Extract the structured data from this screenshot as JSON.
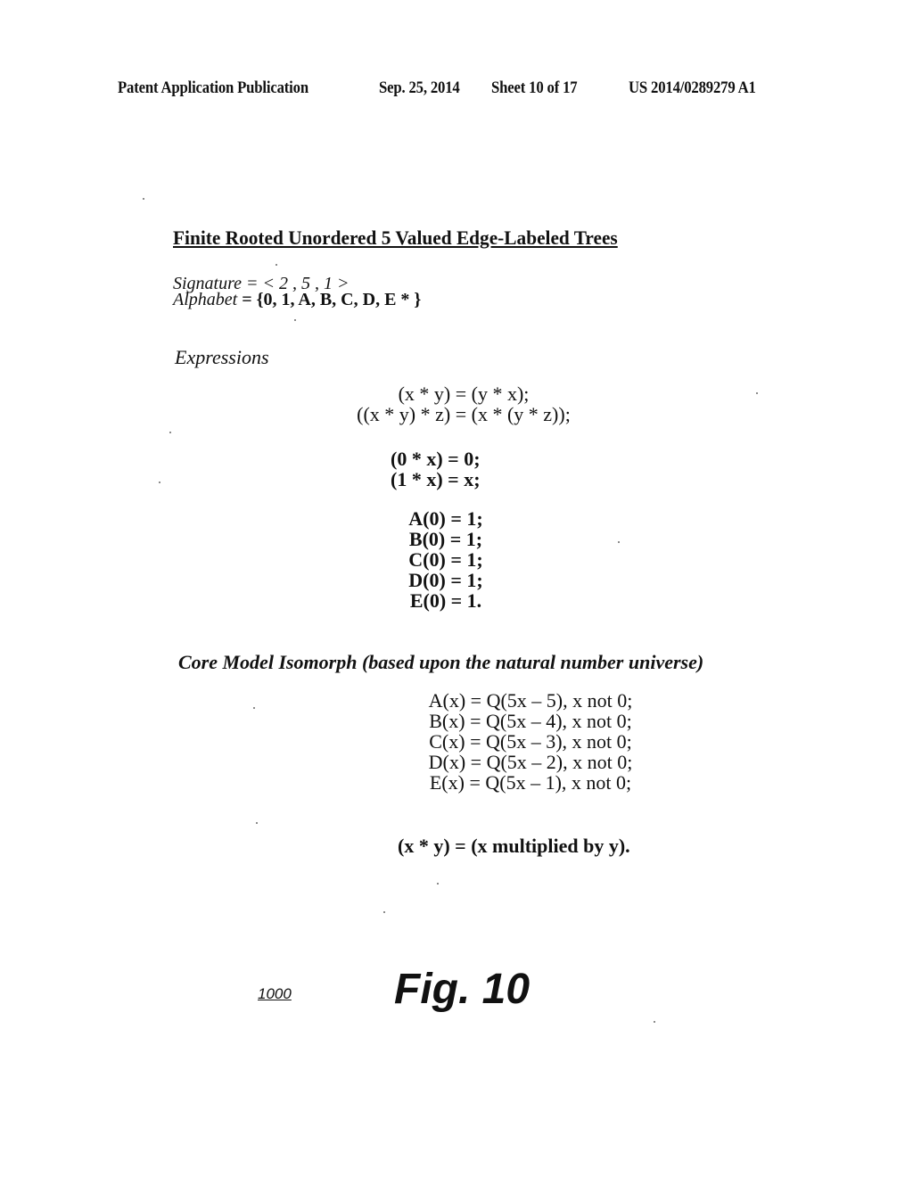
{
  "header": {
    "publication": "Patent Application Publication",
    "date": "Sep. 25, 2014",
    "sheet": "Sheet 10 of 17",
    "number": "US 2014/0289279 A1"
  },
  "title": "Finite Rooted Unordered 5 Valued Edge-Labeled Trees",
  "signature": "Signature = < 2 , 5 , 1 >",
  "alphabet": {
    "label": "Alphabet",
    "value": " = {0, 1, A, B, C, D, E  * }"
  },
  "expressions": {
    "heading": "Expressions",
    "commutative": [
      "(x * y) = (y * x);",
      "((x * y) * z) = (x * (y * z));"
    ],
    "identities": [
      "(0 * x) = 0;",
      "(1 * x) = x;"
    ],
    "base_cases": [
      "A(0) = 1;",
      "B(0) = 1;",
      "C(0) = 1;",
      "D(0) = 1;",
      "E(0) = 1."
    ]
  },
  "core_model": {
    "heading": "Core Model Isomorph (based upon the natural number universe)",
    "equations": [
      "A(x) = Q(5x – 5), x not 0;",
      "B(x) = Q(5x – 4), x not 0;",
      "C(x) = Q(5x – 3), x not 0;",
      "D(x) = Q(5x – 2), x not 0;",
      "E(x) = Q(5x – 1), x not 0;"
    ],
    "multiplication": "(x * y) = (x multiplied by y)."
  },
  "figure": {
    "reference": "1000",
    "label": "Fig. 10"
  }
}
